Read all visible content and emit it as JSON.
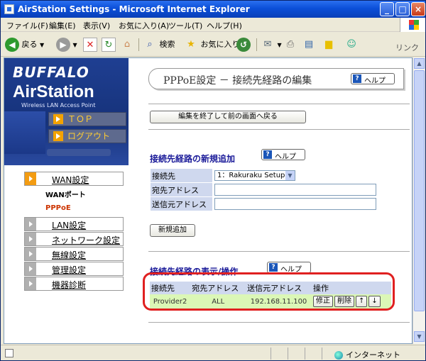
{
  "window": {
    "title": "AirStation Settings - Microsoft Internet Explorer"
  },
  "menubar": [
    "ファイル(F)",
    "編集(E)",
    "表示(V)",
    "お気に入り(A)",
    "ツール(T)",
    "ヘルプ(H)"
  ],
  "toolbar": {
    "back": "戻る",
    "search": "検索",
    "favorites": "お気に入り",
    "links": "リンク"
  },
  "sidebar": {
    "brand_top": "BUFFALO",
    "brand_main": "AirStation",
    "brand_sub": "Wireless LAN Access Point",
    "nav_top": "ＴＯＰ",
    "nav_logout": "ログアウト",
    "groups": [
      {
        "label": "WAN設定"
      },
      {
        "label": "LAN設定"
      },
      {
        "label": "ネットワーク設定"
      },
      {
        "label": "無線設定"
      },
      {
        "label": "管理設定"
      },
      {
        "label": "機器診断"
      }
    ],
    "sub_wanport": "WANポート",
    "sub_pppoe": "PPPoE",
    "colors": {
      "active": "#f39c12",
      "pppoe": "#cc3300"
    }
  },
  "main": {
    "page_title": "PPPoE設定 － 接続先経路の編集",
    "help_label": "ヘルプ",
    "back_button": "編集を終了して前の画面へ戻る",
    "new_section": {
      "title": "接続先経路の新規追加",
      "fields": {
        "connection_label": "接続先",
        "connection_value": "1：Rakuraku Setup",
        "dest_label": "宛先アドレス",
        "src_label": "送信元アドレス"
      },
      "add_button": "新規追加"
    },
    "list_section": {
      "title": "接続先経路の表示/操作",
      "headers": [
        "接続先",
        "宛先アドレス",
        "送信元アドレス",
        "操作"
      ],
      "rows": [
        {
          "connection": "Provider2",
          "dest": "ALL",
          "src": "192.168.11.100"
        }
      ],
      "actions": {
        "edit": "修正",
        "delete": "削除",
        "up": "↑",
        "down": "↓"
      }
    }
  },
  "statusbar": {
    "zone": "インターネット"
  }
}
